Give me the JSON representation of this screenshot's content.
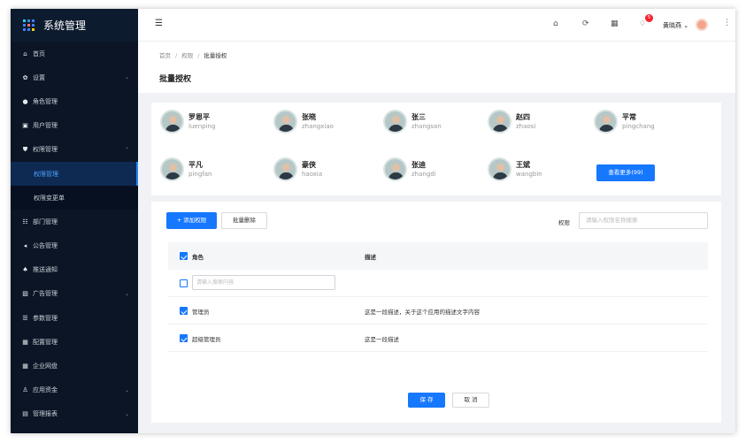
{
  "app": {
    "title": "系统管理"
  },
  "sidebar": {
    "items": [
      {
        "label": "首页",
        "icon": "home-icon",
        "glyph": "⌂"
      },
      {
        "label": "设置",
        "icon": "gear-icon",
        "glyph": "✿",
        "chevron": "⌄"
      },
      {
        "label": "角色管理",
        "icon": "role-icon",
        "glyph": "●"
      },
      {
        "label": "用户管理",
        "icon": "user-card-icon",
        "glyph": "▣"
      },
      {
        "label": "权限管理",
        "icon": "shield-icon",
        "glyph": "⛊",
        "chevron": "⌃"
      },
      {
        "label": "权限管理",
        "sub": true,
        "active": true
      },
      {
        "label": "权限变更单",
        "sub": true
      },
      {
        "label": "部门管理",
        "icon": "team-icon",
        "glyph": "☷"
      },
      {
        "label": "公告管理",
        "icon": "sound-icon",
        "glyph": "◂"
      },
      {
        "label": "推送通知",
        "icon": "bell-icon",
        "glyph": "♠"
      },
      {
        "label": "广告管理",
        "icon": "picture-icon",
        "glyph": "▨",
        "chevron": "⌄"
      },
      {
        "label": "参数管理",
        "icon": "list-icon",
        "glyph": "☰"
      },
      {
        "label": "配置管理",
        "icon": "settings-icon",
        "glyph": "▦"
      },
      {
        "label": "企业网盘",
        "icon": "grid-icon",
        "glyph": "▦"
      },
      {
        "label": "应用资金",
        "icon": "person-icon",
        "glyph": "♙",
        "chevron": "⌄"
      },
      {
        "label": "管理报表",
        "icon": "report-icon",
        "glyph": "▤",
        "chevron": "⌄"
      }
    ]
  },
  "topbar": {
    "user_name": "黄晓燕",
    "notice_count": "5",
    "menu_glyph": "☰",
    "more_glyph": "⋮"
  },
  "page": {
    "breadcrumb": [
      "首页",
      "权限",
      "批量授权"
    ],
    "breadcrumb_sep": "/",
    "title": "批量授权"
  },
  "users": [
    {
      "name": "罗恩平",
      "pinyin": "luenping"
    },
    {
      "name": "张晓",
      "pinyin": "zhangxiao"
    },
    {
      "name": "张三",
      "pinyin": "zhangsan"
    },
    {
      "name": "赵四",
      "pinyin": "zhaosi"
    },
    {
      "name": "平常",
      "pinyin": "pingchang"
    },
    {
      "name": "平凡",
      "pinyin": "pingfan"
    },
    {
      "name": "豪侠",
      "pinyin": "haoxia"
    },
    {
      "name": "张迪",
      "pinyin": "zhangdi"
    },
    {
      "name": "王斌",
      "pinyin": "wangbin"
    }
  ],
  "view_more": "查看更多(99)",
  "toolbar": {
    "add_label": "+ 添加权限",
    "batch_delete_label": "批量删除"
  },
  "search": {
    "label": "权限",
    "placeholder": "请输入权限名称搜索"
  },
  "table": {
    "headers": [
      "角色",
      "描述"
    ],
    "filter_placeholder": "请输入搜索内容",
    "rows": [
      {
        "role": "管理员",
        "desc": "这是一段描述，关于这个应用的描述文字内容"
      },
      {
        "role": "超级管理员",
        "desc": "这是一段描述"
      }
    ]
  },
  "actions": {
    "save": "保 存",
    "cancel": "取 消"
  },
  "colors": {
    "primary": "#1677ff",
    "sidebar_bg": "#0b1526",
    "badge": "#f5222d"
  }
}
